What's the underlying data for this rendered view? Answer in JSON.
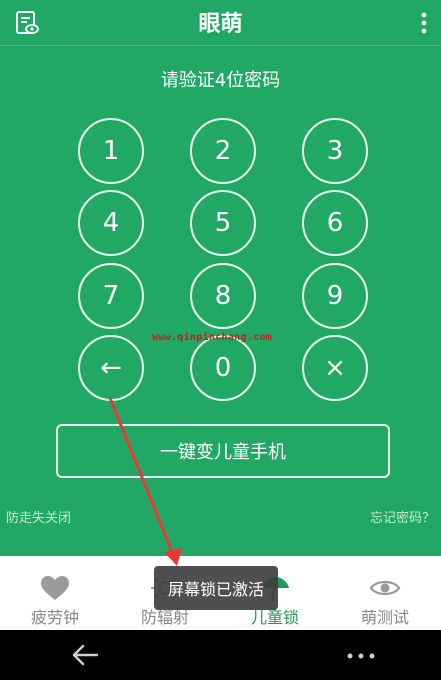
{
  "header": {
    "title": "眼萌",
    "left_icon": "document-eye-icon",
    "right_icon": "more-vertical-icon"
  },
  "prompt": "请验证4位密码",
  "keypad": {
    "keys": [
      "1",
      "2",
      "3",
      "4",
      "5",
      "6",
      "7",
      "8",
      "9",
      "←",
      "0",
      "×"
    ]
  },
  "watermark": "www.qinpinchang.com",
  "child_mode_button": "一键变儿童手机",
  "links": {
    "left": "防走失关闭",
    "right": "忘记密码？"
  },
  "tabs": [
    {
      "label": "疲劳钟",
      "icon": "heart-icon",
      "active": false
    },
    {
      "label": "防辐射",
      "icon": "sun-icon",
      "active": false
    },
    {
      "label": "儿童锁",
      "icon": "umbrella-icon",
      "active": true
    },
    {
      "label": "萌测试",
      "icon": "eye-icon",
      "active": false
    }
  ],
  "toast": "屏幕锁已激活",
  "colors": {
    "brand_green": "#22a865",
    "active_tab": "#1e9a5a",
    "annotation_red": "#e53935"
  }
}
